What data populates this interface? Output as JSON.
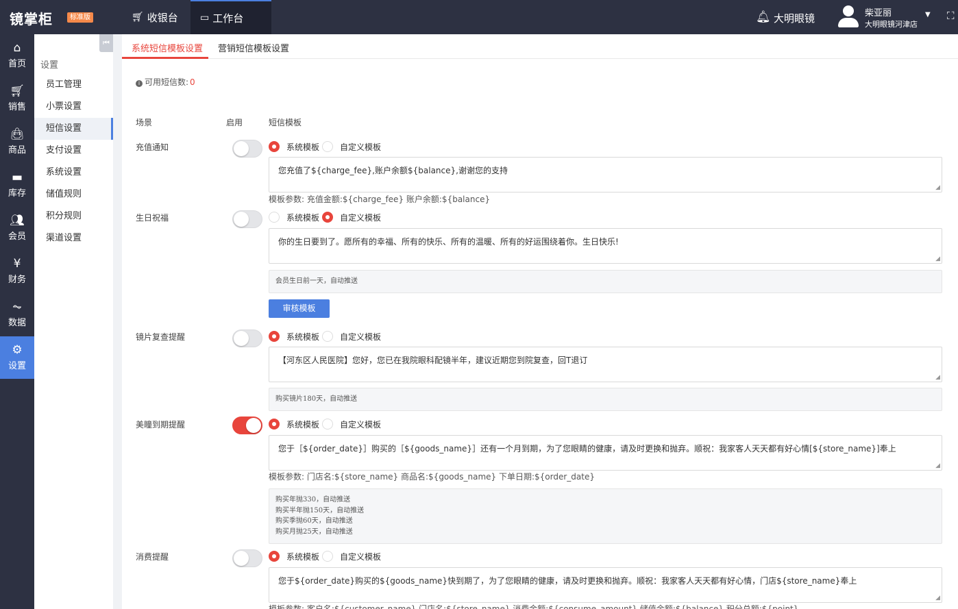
{
  "topbar": {
    "brand": "镜掌柜",
    "edition": "标准版",
    "nav_cashier": "收银台",
    "nav_workbench": "工作台",
    "store_name": "大明眼镜",
    "user_name": "柴亚丽",
    "user_store": "大明眼镜河津店"
  },
  "leftnav": [
    {
      "label": "首页",
      "icon": "home-icon"
    },
    {
      "label": "销售",
      "icon": "cart-icon"
    },
    {
      "label": "商品",
      "icon": "bag-icon"
    },
    {
      "label": "库存",
      "icon": "inbox-icon"
    },
    {
      "label": "会员",
      "icon": "users-icon"
    },
    {
      "label": "财务",
      "icon": "yen-icon"
    },
    {
      "label": "数据",
      "icon": "pulse-icon"
    },
    {
      "label": "设置",
      "icon": "gear-icon"
    }
  ],
  "submenu": {
    "title": "设置",
    "items": [
      "员工管理",
      "小票设置",
      "短信设置",
      "支付设置",
      "系统设置",
      "储值规则",
      "积分规则",
      "渠道设置"
    ]
  },
  "tabs": [
    "系统短信模板设置",
    "营销短信模板设置"
  ],
  "sms_count": {
    "label": "可用短信数:",
    "value": "0"
  },
  "columns": [
    "场景",
    "启用",
    "短信模板"
  ],
  "radio_labels": [
    "系统模板",
    "自定义模板"
  ],
  "rows": [
    {
      "scene": "充值通知",
      "template": "您充值了${charge_fee},账户余额${balance},谢谢您的支持",
      "params": "模板参数:   充值金额:${charge_fee}    账户余额:${balance}"
    },
    {
      "scene": "生日祝福",
      "template": "你的生日要到了。愿所有的幸福、所有的快乐、所有的温暖、所有的好运围绕着你。生日快乐!",
      "note": "会员生日前一天，自动推送",
      "review_button": "审核模板"
    },
    {
      "scene": "镜片复查提醒",
      "template": "【河东区人民医院】您好，您已在我院眼科配镜半年，建议近期您到院复查，回T退订",
      "note": "购买镜片180天，自动推送"
    },
    {
      "scene": "美瞳到期提醒",
      "template": "您于［${order_date}］购买的［${goods_name}］还有一个月到期，为了您眼睛的健康，请及时更换和抛弃。顺祝：我家客人天天都有好心情[${store_name}]奉上",
      "params": "模板参数:   门店名:${store_name}    商品名:${goods_name}    下单日期:${order_date}",
      "note_lines": [
        "购买年抛330，自动推送",
        "购买半年抛150天，自动推送",
        "购买季抛60天，自动推送",
        "购买月抛25天，自动推送"
      ]
    },
    {
      "scene": "消费提醒",
      "template": "您于${order_date}购买的${goods_name}快到期了，为了您眼睛的健康，请及时更换和抛弃。顺祝：我家客人天天都有好心情，门店${store_name}奉上",
      "params": "模板参数:   客户名:${customer_name}    门店名:${store_name}    消费金额:${consume_amount}    储值余额:${balance}    积分总额:${point}"
    }
  ],
  "colors": {
    "sidebar": "#2d3142",
    "accent": "#4b7fe0",
    "danger": "#e8453c"
  }
}
